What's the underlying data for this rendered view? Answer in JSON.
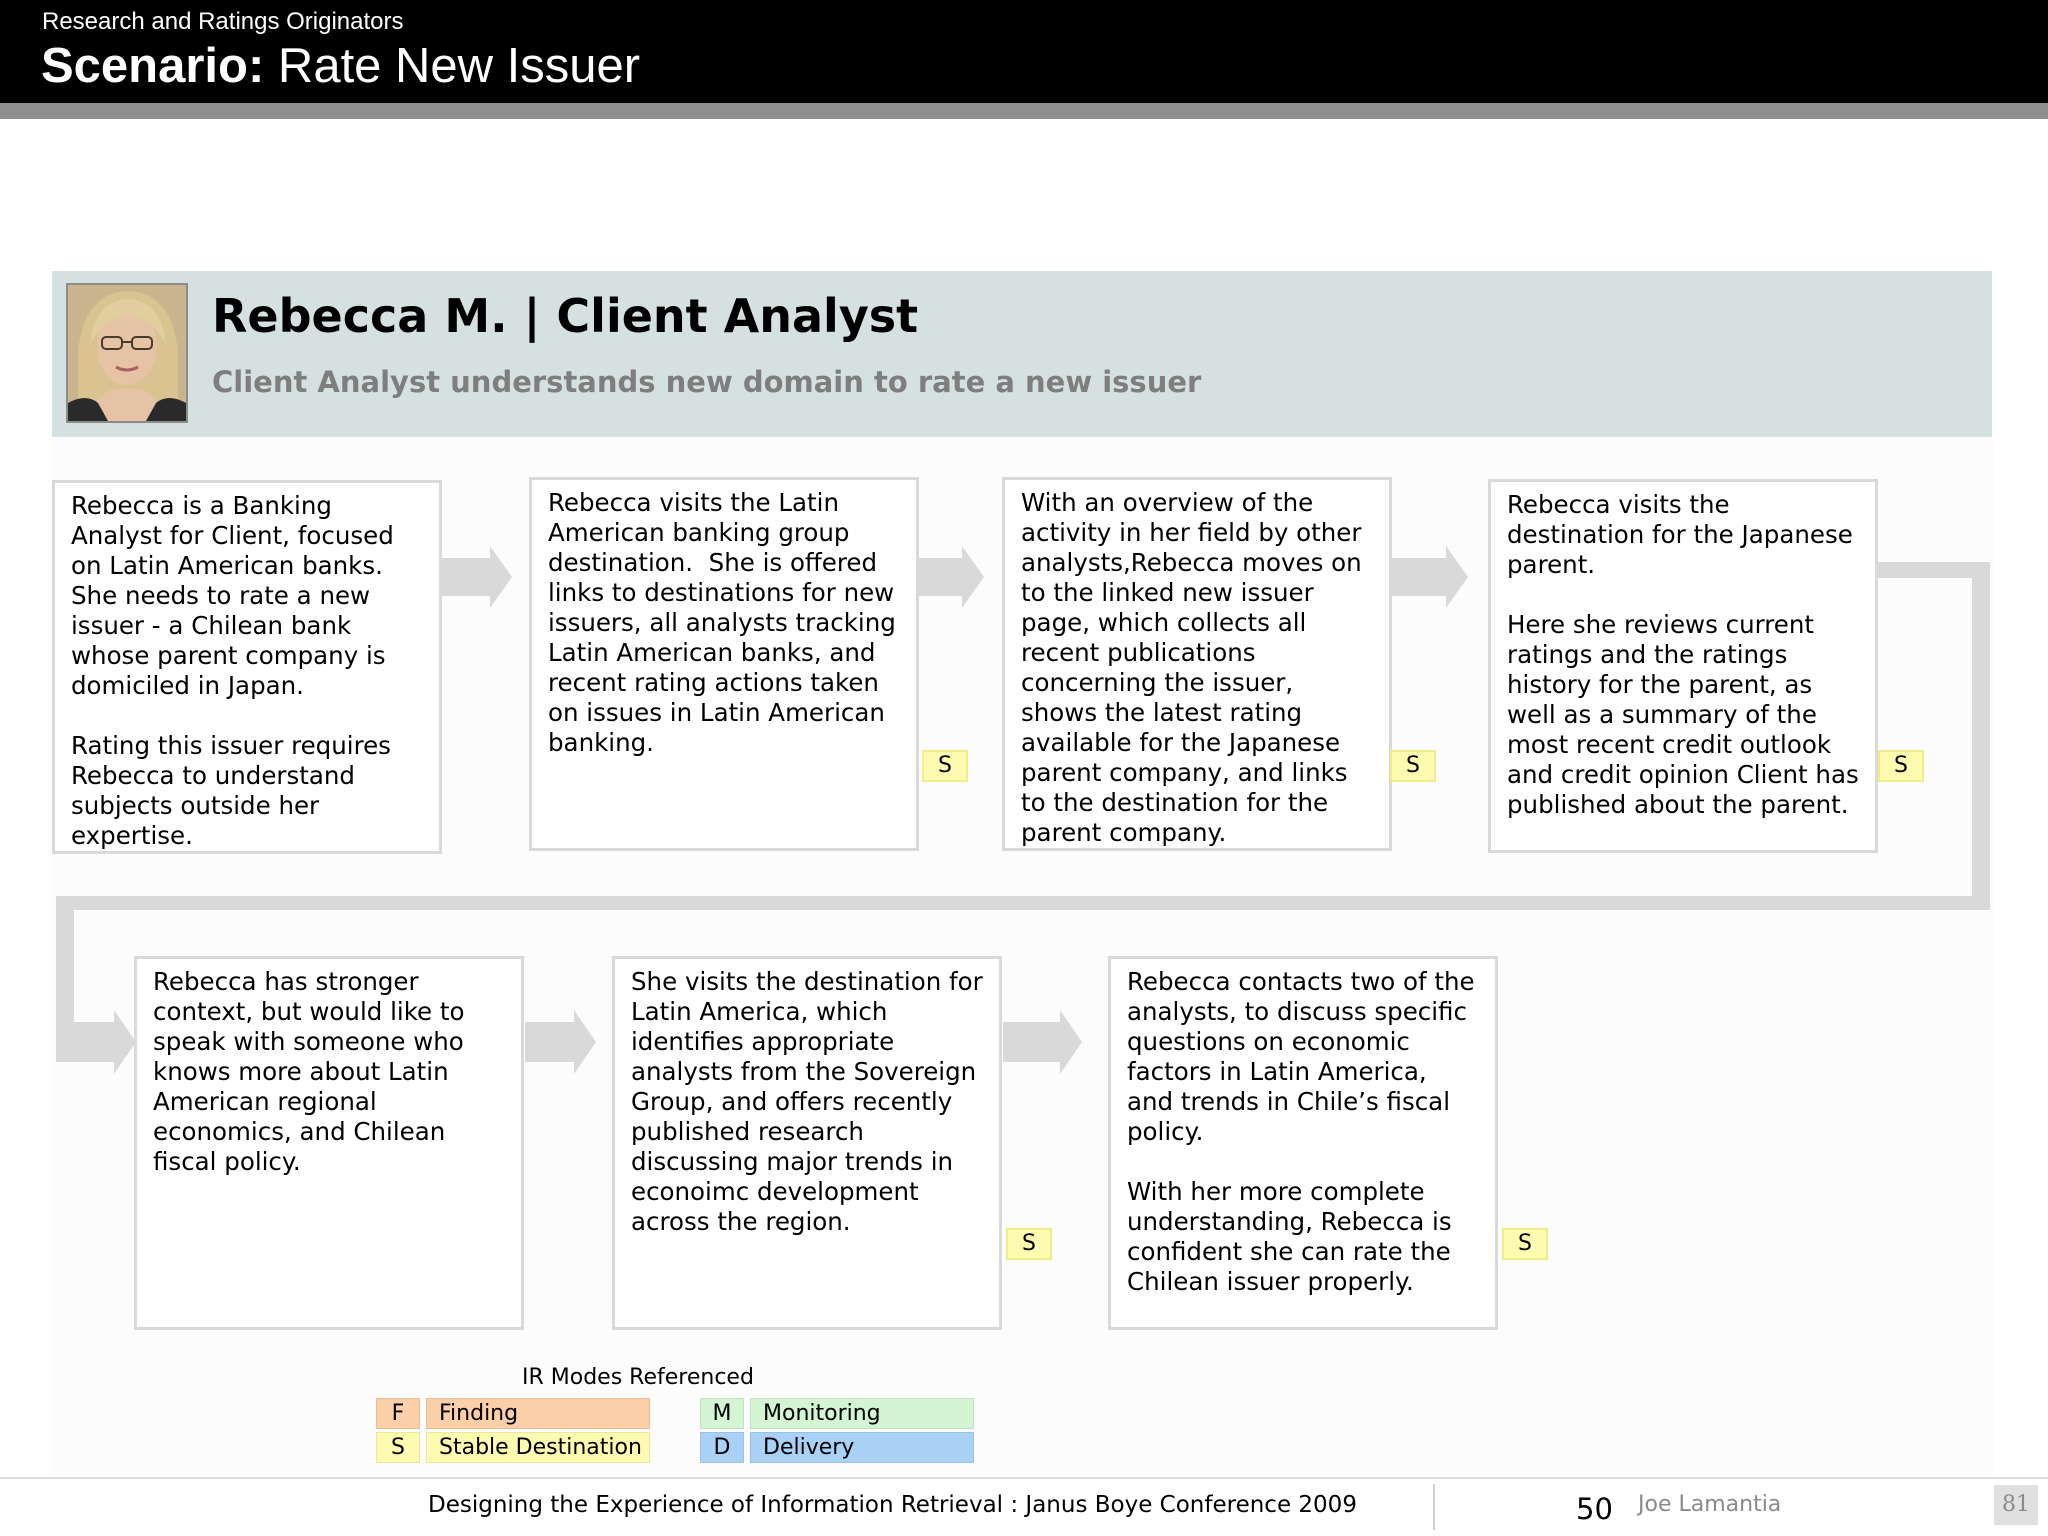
{
  "header": {
    "subtitle": "Research and Ratings Originators",
    "title_bold": "Scenario:",
    "title_rest": " Rate New Issuer",
    "bar_color": "#000000",
    "stripe_color": "#8e8e8e"
  },
  "persona": {
    "name": "Rebecca M. | Client Analyst",
    "description": "Client Analyst understands new domain to rate a new issuer",
    "photo_alt": "portrait photo of Rebecca M.",
    "background_color": "#d5e0e0"
  },
  "steps": [
    {
      "text": "Rebecca is a Banking Analyst for Client, focused on Latin American banks.  She needs to rate a new issuer - a Chilean bank whose parent company is domiciled in Japan.\n\nRating this issuer requires Rebecca to understand subjects outside her expertise.",
      "badge": ""
    },
    {
      "text": "Rebecca visits the Latin American banking group destination.  She is offered links to destinations for new issuers, all analysts tracking Latin American banks, and recent rating actions taken on issues in Latin American banking.",
      "badge": "S"
    },
    {
      "text": "With an overview of the activity in her field by other analysts,Rebecca moves on to the linked new issuer page, which collects all recent publications concerning the issuer, shows the latest rating available for the Japanese parent company, and links to the destination for the parent company.",
      "badge": "S"
    },
    {
      "text": "Rebecca visits the destination for the Japanese parent.\n\nHere she reviews current ratings and the ratings history for the parent, as well as a summary of the most recent credit outlook and credit opinion Client has published about the parent.",
      "badge": "S"
    },
    {
      "text": "Rebecca has stronger context, but would like to speak with someone who knows more about Latin American regional economics, and Chilean fiscal policy.",
      "badge": ""
    },
    {
      "text": "She visits the destination for Latin America, which identifies appropriate analysts from the Sovereign Group, and offers recently published research discussing major trends in econoimc development across the region.",
      "badge": "S"
    },
    {
      "text": "Rebecca contacts two of the analysts, to discuss specific questions on economic factors in Latin America, and trends in Chile’s fiscal policy.\n\nWith her more complete understanding, Rebecca is confident she can rate the Chilean issuer properly.",
      "badge": "S"
    }
  ],
  "legend": {
    "title": "IR Modes Referenced",
    "items": [
      {
        "code": "F",
        "label": "Finding",
        "color": "#fbcfa7"
      },
      {
        "code": "S",
        "label": "Stable Destination",
        "color": "#fdfbb0"
      },
      {
        "code": "M",
        "label": "Monitoring",
        "color": "#d3f5d3"
      },
      {
        "code": "D",
        "label": "Delivery",
        "color": "#a9d1f6"
      }
    ]
  },
  "footer": {
    "text": "Designing the Experience of Information Retrieval : Janus Boye Conference 2009",
    "slide_number": "50",
    "author": "Joe Lamantia",
    "page_number": "81"
  },
  "colors": {
    "flow_arrow": "#d9d9d9",
    "card_border": "#d9d9d9",
    "badge_fill": "#fdfbb0"
  }
}
